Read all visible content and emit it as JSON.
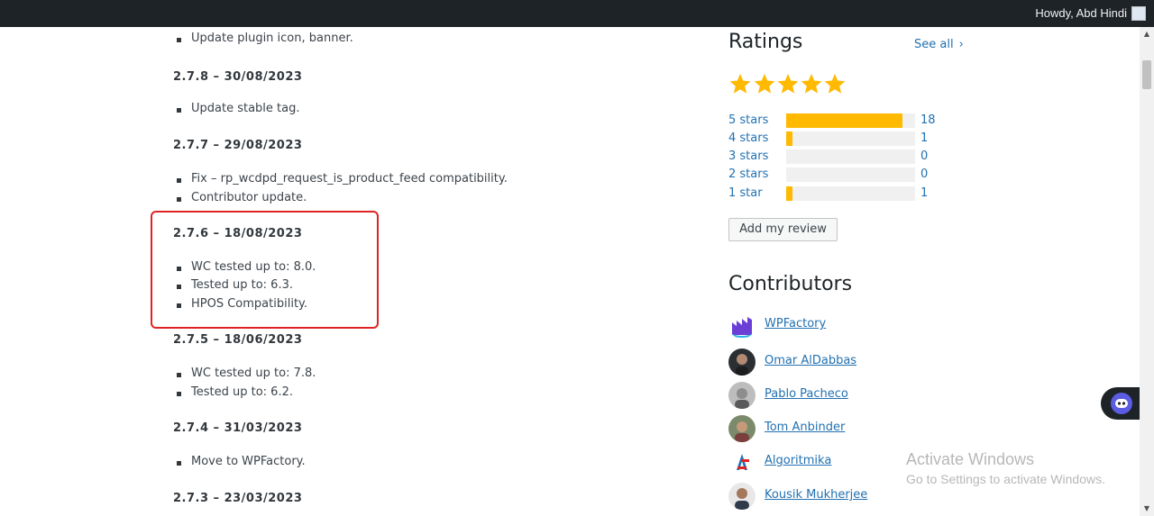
{
  "adminbar": {
    "greeting": "Howdy, Abd Hindi"
  },
  "changelog": {
    "entries": [
      {
        "items": [
          "Update plugin icon, banner."
        ]
      },
      {
        "version": "2.7.8 – 30/08/2023",
        "items": [
          "Update stable tag."
        ]
      },
      {
        "version": "2.7.7 – 29/08/2023",
        "items": [
          "Fix – rp_wcdpd_request_is_product_feed compatibility.",
          "Contributor update."
        ]
      },
      {
        "version": "2.7.6 – 18/08/2023",
        "items": [
          "WC tested up to: 8.0.",
          "Tested up to: 6.3.",
          "HPOS Compatibility."
        ]
      },
      {
        "version": "2.7.5 – 18/06/2023",
        "items": [
          "WC tested up to: 7.8.",
          "Tested up to: 6.2."
        ]
      },
      {
        "version": "2.7.4 – 31/03/2023",
        "items": [
          "Move to WPFactory."
        ]
      },
      {
        "version": "2.7.3 – 23/03/2023",
        "items": []
      }
    ]
  },
  "ratings": {
    "title": "Ratings",
    "see_all": "See all",
    "average_stars": 5,
    "rows": [
      {
        "label": "5 stars",
        "count": "18",
        "fraction": 0.9
      },
      {
        "label": "4 stars",
        "count": "1",
        "fraction": 0.05
      },
      {
        "label": "3 stars",
        "count": "0",
        "fraction": 0
      },
      {
        "label": "2 stars",
        "count": "0",
        "fraction": 0
      },
      {
        "label": "1 star",
        "count": "1",
        "fraction": 0.05
      }
    ],
    "add_review": "Add my review",
    "star_color": "#ffb900"
  },
  "contributors": {
    "title": "Contributors",
    "list": [
      {
        "name": "WPFactory",
        "avatar": "wpfactory-logo"
      },
      {
        "name": "Omar AlDabbas",
        "avatar": "person-photo"
      },
      {
        "name": "Pablo Pacheco",
        "avatar": "person-photo"
      },
      {
        "name": "Tom Anbinder",
        "avatar": "person-photo"
      },
      {
        "name": "Algoritmika",
        "avatar": "algoritmika-logo"
      },
      {
        "name": "Kousik Mukherjee",
        "avatar": "person-photo"
      }
    ]
  },
  "watermark": {
    "title": "Activate Windows",
    "subtitle": "Go to Settings to activate Windows."
  },
  "theme": {
    "link": "#2271b1",
    "highlight_border": "#e02424",
    "adminbar": "#1d2327"
  }
}
